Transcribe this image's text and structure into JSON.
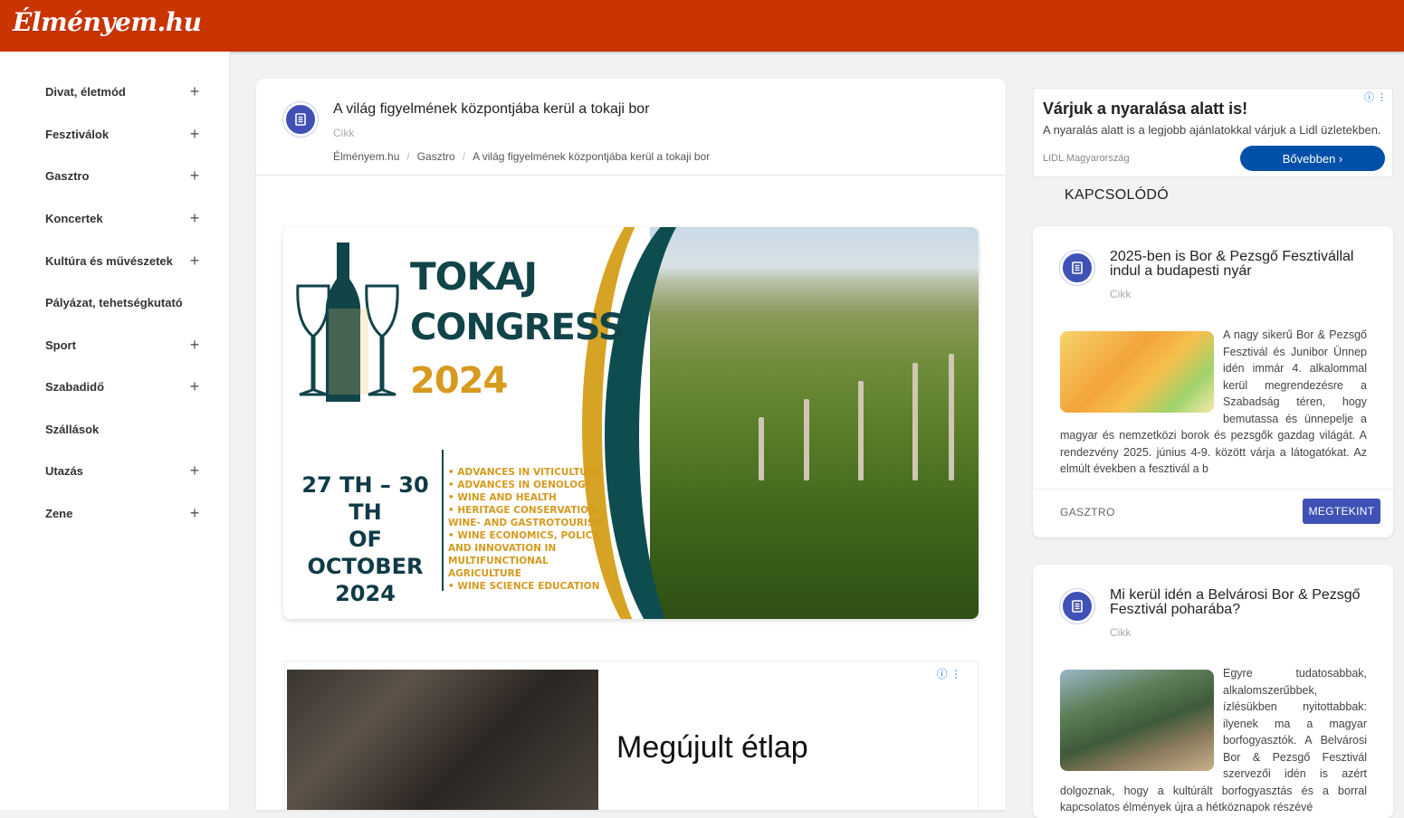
{
  "site": {
    "logo": "Élményem.hu"
  },
  "sidebar": {
    "items": [
      {
        "label": "Divat, életmód",
        "expand": "+"
      },
      {
        "label": "Fesztiválok",
        "expand": "+"
      },
      {
        "label": "Gasztro",
        "expand": "+"
      },
      {
        "label": "Koncertek",
        "expand": "+"
      },
      {
        "label": "Kultúra és művészetek",
        "expand": "+"
      },
      {
        "label": "Pályázat, tehetségkutató",
        "expand": ""
      },
      {
        "label": "Sport",
        "expand": "+"
      },
      {
        "label": "Szabadidő",
        "expand": "+"
      },
      {
        "label": "Szállások",
        "expand": ""
      },
      {
        "label": "Utazás",
        "expand": "+"
      },
      {
        "label": "Zene",
        "expand": "+"
      }
    ]
  },
  "article": {
    "title": "A világ figyelmének központjába kerül a tokaji bor",
    "type": "Cikk",
    "breadcrumb": [
      "Élményem.hu",
      "Gasztro",
      "A világ figyelmének központjába kerül a tokaji bor"
    ],
    "breadcrumb_sep": "/",
    "banner": {
      "title1": "TOKAJ",
      "title2": "CONGRESS",
      "year": "2024",
      "dates1": "27 TH – 30 TH",
      "dates2": "OF OCTOBER",
      "dates3": "2024",
      "topics": [
        "• ADVANCES IN VITICULTURE",
        "• ADVANCES IN OENOLOGY",
        "• WINE AND HEALTH",
        "• HERITAGE CONSERVATION,",
        "WINE- AND GASTROTOURISM",
        "• WINE ECONOMICS, POLICY,",
        "AND INNOVATION IN MULTIFUNCTIONAL",
        "AGRICULTURE",
        "• WINE SCIENCE EDUCATION"
      ]
    },
    "ad": {
      "headline": "Megújult étlap",
      "info_icon": "ⓘ ⋮"
    }
  },
  "lidl_ad": {
    "title": "Várjuk a nyaralása alatt is!",
    "subtitle": "A nyaralás alatt is a legjobb ajánlatokkal várjuk a Lidl üzletekben.",
    "brand": "LIDL Magyarország",
    "button": "Bővebben ›",
    "info_icon": "ⓘ ⋮"
  },
  "related": {
    "heading": "KAPCSOLÓDÓ",
    "cards": [
      {
        "title": "2025-ben is Bor & Pezsgő Fesztivállal indul a budapesti nyár",
        "type": "Cikk",
        "text": "A nagy sikerű Bor & Pezsgő Fesztivál és Junibor Ünnep idén immár 4. alkalommal kerül megrendezésre a Szabadság téren, hogy bemutassa és ünnepelje a magyar és nemzetközi borok és pezsgők gazdag világát. A rendezvény 2025. június 4-9. között várja a látogatókat. Az elmúlt években a fesztivál a b",
        "category": "GASZTRO",
        "button": "MEGTEKINT"
      },
      {
        "title": "Mi kerül idén a Belvárosi Bor & Pezsgő Fesztivál poharába?",
        "type": "Cikk",
        "text": "Egyre tudatosabbak, alkalomszerűbbek, ízlésükben nyitottabbak: ilyenek ma a magyar borfogyasztók. A Belvárosi Bor & Pezsgő Fesztivál szervezői idén is azért dolgoznak, hogy a kultúrált borfogyasztás és a borral kapcsolatos élmények újra a hétköznapok részévé"
      }
    ]
  },
  "colors": {
    "topbar": "#c93400",
    "accent": "#3f51b5",
    "lidl_button": "#0050aa"
  }
}
